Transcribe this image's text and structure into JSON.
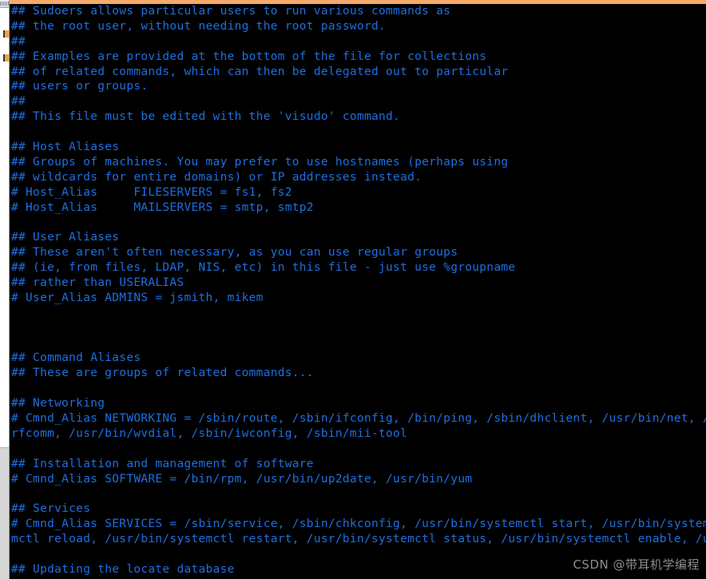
{
  "window": {
    "titlebar_color": "#f5a96a",
    "background_color": "#000000",
    "text_color": "#1e6fe0",
    "cursor_color": "#19d219"
  },
  "terminal": {
    "cursor": {
      "char": "#",
      "line_index": 36,
      "column": 0
    },
    "lines": [
      "## Sudoers allows particular users to run various commands as",
      "## the root user, without needing the root password.",
      "##",
      "## Examples are provided at the bottom of the file for collections",
      "## of related commands, which can then be delegated out to particular",
      "## users or groups.",
      "##",
      "## This file must be edited with the 'visudo' command.",
      "",
      "## Host Aliases",
      "## Groups of machines. You may prefer to use hostnames (perhaps using",
      "## wildcards for entire domains) or IP addresses instead.",
      "# Host_Alias     FILESERVERS = fs1, fs2",
      "# Host_Alias     MAILSERVERS = smtp, smtp2",
      "",
      "## User Aliases",
      "## These aren't often necessary, as you can use regular groups",
      "## (ie, from files, LDAP, NIS, etc) in this file - just use %groupname",
      "## rather than USERALIAS",
      "# User_Alias ADMINS = jsmith, mikem",
      "",
      "",
      "",
      "## Command Aliases",
      "## These are groups of related commands...",
      "",
      "## Networking",
      "# Cmnd_Alias NETWORKING = /sbin/route, /sbin/ifconfig, /bin/ping, /sbin/dhclient, /usr/bin/net, /",
      "rfcomm, /usr/bin/wvdial, /sbin/iwconfig, /sbin/mii-tool",
      "",
      "## Installation and management of software",
      "# Cmnd_Alias SOFTWARE = /bin/rpm, /usr/bin/up2date, /usr/bin/yum",
      "",
      "## Services",
      "# Cmnd_Alias SERVICES = /sbin/service, /sbin/chkconfig, /usr/bin/systemctl start, /usr/bin/system",
      "mctl reload, /usr/bin/systemctl restart, /usr/bin/systemctl status, /usr/bin/systemctl enable, /u",
      "",
      "## Updating the locate database"
    ]
  },
  "watermark": {
    "text": "CSDN @带耳机学编程"
  }
}
